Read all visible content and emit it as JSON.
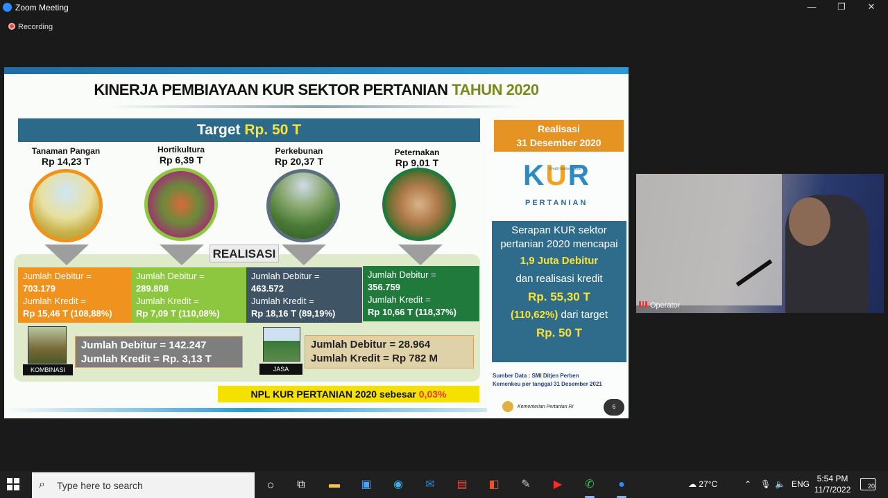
{
  "window": {
    "title": "Zoom Meeting",
    "recording": "Recording"
  },
  "slide": {
    "title_main": "KINERJA PEMBIAYAAN KUR SEKTOR PERTANIAN",
    "title_accent": "TAHUN 2020",
    "target_label": "Target",
    "target_value": "Rp. 50 T",
    "categories": [
      {
        "name": "Tanaman Pangan",
        "amount": "Rp 14,23 T"
      },
      {
        "name": "Hortikultura",
        "amount": "Rp 6,39 T"
      },
      {
        "name": "Perkebunan",
        "amount": "Rp 20,37 T"
      },
      {
        "name": "Peternakan",
        "amount": "Rp 9,01 T"
      }
    ],
    "realisasi_header": "REALISASI",
    "boxes": [
      {
        "l1": "Jumlah Debitur =",
        "l2": "703.179",
        "l3": "Jumlah Kredit =",
        "l4": "Rp 15,46 T (108,88%)",
        "color": "#f0921e"
      },
      {
        "l1": "Jumlah Debitur =",
        "l2": "289.808",
        "l3": "Jumlah Kredit =",
        "l4": "Rp 7,09 T (110,08%)",
        "color": "#8dc63f"
      },
      {
        "l1": "Jumlah Debitur =",
        "l2": "463.572",
        "l3": "Jumlah Kredit =",
        "l4": "Rp 18,16 T (89,19%)",
        "color": "#3f5566"
      },
      {
        "l1": "Jumlah Debitur =",
        "l2": "356.759",
        "l3": "Jumlah Kredit =",
        "l4": "Rp 10,66 T (118,37%)",
        "color": "#1f7a3c"
      }
    ],
    "kombinasi": {
      "label": "KOMBINASI",
      "l1": "Jumlah Debitur = 142.247",
      "l2": "Jumlah Kredit = Rp. 3,13 T"
    },
    "jasa": {
      "label": "JASA",
      "l1": "Jumlah Debitur = 28.964",
      "l2": "Jumlah Kredit = Rp 782 M"
    },
    "npl_text": "NPL KUR PERTANIAN 2020 sebesar",
    "npl_value": "0,03%",
    "realisasi_box": {
      "l1": "Realisasi",
      "l2": "31 Desember 2020"
    },
    "kur_logo": {
      "k": "K",
      "u": "U",
      "r": "R",
      "tiny": "Kredit Usaha Rakyat",
      "sub": "PERTANIAN"
    },
    "serapan": {
      "l1": "Serapan KUR sektor pertanian 2020 mencapai",
      "debitur": "1,9 Juta Debitur",
      "l2": "dan realisasi kredit",
      "kredit": "Rp. 55,30 T",
      "pct": "(110,62%)",
      "l3": "dari target",
      "target": "Rp. 50 T"
    },
    "sumber_l1": "Sumber Data : SMI Ditjen Perben",
    "sumber_l2": "Kemenkeu per tanggal 31 Desember 2021",
    "kementerian": "Kementerian Pertanian RI",
    "page": "6"
  },
  "video": {
    "name": "Operator"
  },
  "taskbar": {
    "search_placeholder": "Type here to search",
    "weather": "27°C",
    "lang": "ENG",
    "time": "5:54 PM",
    "date": "11/7/2022",
    "notifications": "20"
  }
}
